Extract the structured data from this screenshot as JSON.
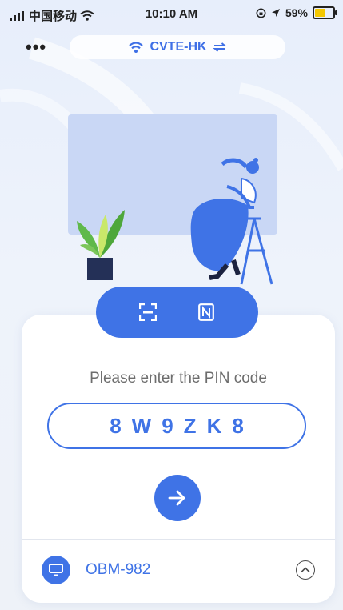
{
  "status_bar": {
    "carrier": "中国移动",
    "time": "10:10 AM",
    "battery": "59%"
  },
  "header": {
    "more_label": "•••",
    "wifi_name": "CVTE-HK"
  },
  "main": {
    "pin_label": "Please enter the PIN code",
    "pin_chars": [
      "8",
      "W",
      "9",
      "Z",
      "K",
      "8"
    ]
  },
  "device": {
    "name": "OBM-982"
  },
  "colors": {
    "accent": "#3f73e6",
    "background": "#eef3fb"
  },
  "icons": {
    "scan": "scan-icon",
    "nfc": "nfc-icon",
    "go": "arrow-right-icon",
    "device": "monitor-icon",
    "expand": "chevron-up-icon"
  }
}
